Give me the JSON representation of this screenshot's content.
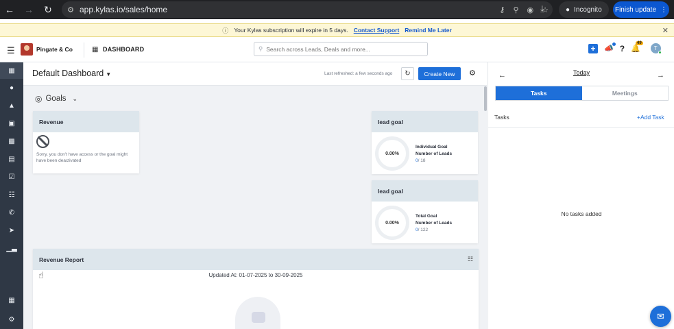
{
  "browser": {
    "url": "app.kylas.io/sales/home",
    "incognito_label": "Incognito",
    "update_label": "Finish update"
  },
  "banner": {
    "message": "Your Kylas subscription will expire in 5 days.",
    "contact_support": "Contact Support",
    "remind_later": "Remind Me Later"
  },
  "appbar": {
    "company": "Pingate & Co",
    "section_title": "DASHBOARD",
    "search_placeholder": "Search across Leads, Deals and more...",
    "notification_count": "49",
    "avatar_initial": "T"
  },
  "dashboard": {
    "name": "Default Dashboard",
    "last_refreshed": "Last refreshed: a few seconds ago",
    "create_new": "Create New",
    "goals_label": "Goals"
  },
  "revenue_card": {
    "title": "Revenue",
    "message": "Sorry, you don't have access or the goal might have been deactivated"
  },
  "goal_cards": [
    {
      "title": "lead goal",
      "percent": "0.00%",
      "goal_type": "Individual Goal",
      "metric": "Number of Leads",
      "achieved": "0",
      "target": "/ 18"
    },
    {
      "title": "lead goal",
      "percent": "0.00%",
      "goal_type": "Total Goal",
      "metric": "Number of Leads",
      "achieved": "0",
      "target": "/ 122"
    }
  ],
  "revenue_report": {
    "title": "Revenue Report",
    "updated": "Updated At: 01-07-2025 to 30-09-2025"
  },
  "right_panel": {
    "date_label": "Today",
    "tabs": [
      "Tasks",
      "Meetings"
    ],
    "active_tab": "Tasks",
    "tasks_label": "Tasks",
    "add_task": "Add Task",
    "empty_message": "No tasks added"
  },
  "colors": {
    "primary": "#1e6fd9",
    "sidebar": "#2f3845",
    "card_header": "#dde6ec",
    "banner": "#fdf7d6"
  }
}
